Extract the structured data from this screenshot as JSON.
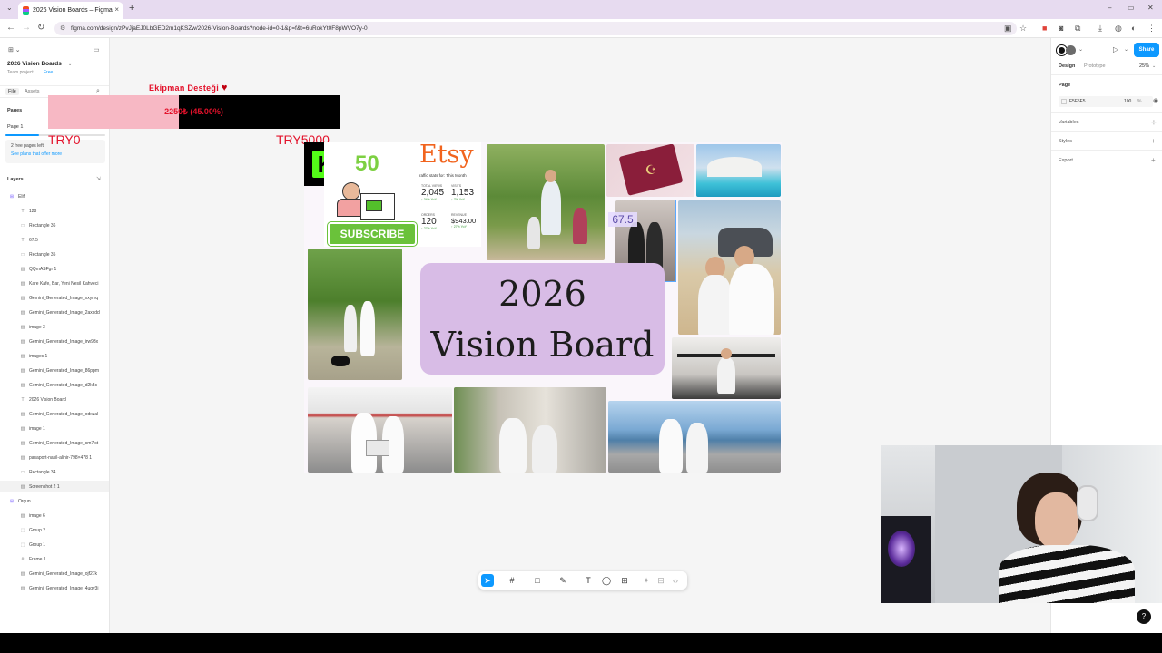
{
  "browser": {
    "tab_title": "2026 Vision Boards – Figma",
    "tab_close": "×",
    "new_tab": "+",
    "url": "figma.com/design/zPvJjaEJ0LbGED2m1qKSZw/2026-Vision-Boards?node-id=0-1&p=f&t=6uRokYt0F8pWVO7y-0",
    "window_minimize": "–",
    "window_maximize": "▭",
    "window_close": "✕"
  },
  "left_panel": {
    "file_name": "2026 Vision Boards",
    "team": "Team project",
    "plan": "Free",
    "tab_file": "File",
    "tab_assets": "Assets",
    "pages_header": "Pages",
    "page_1": "Page 1",
    "pages_left": "2 free pages left",
    "see_plans": "See plans that offer more",
    "layers_header": "Layers",
    "layers": [
      {
        "name": "Elif",
        "type": "section"
      },
      {
        "name": "128",
        "type": "text"
      },
      {
        "name": "Rectangle 36",
        "type": "rect"
      },
      {
        "name": "67.5",
        "type": "text"
      },
      {
        "name": "Rectangle 35",
        "type": "rect"
      },
      {
        "name": "QQmASFgr 1",
        "type": "image"
      },
      {
        "name": "Kare Kafe, Bar, Yeni Nesil Kahveci",
        "type": "image"
      },
      {
        "name": "Gemini_Generated_Image_xxymq",
        "type": "image"
      },
      {
        "name": "Gemini_Generated_Image_2axcdd",
        "type": "image"
      },
      {
        "name": "image 3",
        "type": "image"
      },
      {
        "name": "Gemini_Generated_Image_irw93x",
        "type": "image"
      },
      {
        "name": "images 1",
        "type": "image"
      },
      {
        "name": "Gemini_Generated_Image_86ppm",
        "type": "image"
      },
      {
        "name": "Gemini_Generated_Image_d2k5c",
        "type": "image"
      },
      {
        "name": "2026 Vision Board",
        "type": "text"
      },
      {
        "name": "Gemini_Generated_Image_odxzal",
        "type": "image"
      },
      {
        "name": "image 1",
        "type": "image"
      },
      {
        "name": "Gemini_Generated_Image_sm7jst",
        "type": "image"
      },
      {
        "name": "pasaport-nasil-alinir-798×478 1",
        "type": "image"
      },
      {
        "name": "Rectangle 34",
        "type": "rect"
      },
      {
        "name": "Screenshot 2 1",
        "type": "image"
      },
      {
        "name": "Orçun",
        "type": "section"
      },
      {
        "name": "image 6",
        "type": "image"
      },
      {
        "name": "Group 2",
        "type": "group"
      },
      {
        "name": "Group 1",
        "type": "group"
      },
      {
        "name": "Frame 1",
        "type": "frame"
      },
      {
        "name": "Gemini_Generated_Image_ojf27k",
        "type": "image"
      },
      {
        "name": "Gemini_Generated_Image_4ugv3j",
        "type": "image"
      }
    ]
  },
  "right_panel": {
    "tab_design": "Design",
    "tab_prototype": "Prototype",
    "zoom": "25%",
    "share": "Share",
    "page_header": "Page",
    "page_color": "F5F5F5",
    "page_opacity": "100",
    "percent": "%",
    "variables": "Variables",
    "styles": "Styles",
    "export": "Export"
  },
  "canvas": {
    "donation_title": "Ekipman Desteği",
    "donation_heart": "♥",
    "progress_text": "2250₺ (45.00%)",
    "progress_fraction": 0.45,
    "goal_start": "TRY0",
    "goal_end": "TRY5000",
    "kick_logo": "K",
    "kick_number": "50",
    "subscribe": "SUBSCRIBE",
    "etsy": {
      "logo": "Etsy",
      "subtitle": "raffic stats for: This Month",
      "stats": [
        {
          "label": "TOTAL VIEWS",
          "value": "2,045",
          "note": "↑ 34% YoY"
        },
        {
          "label": "VISITS",
          "value": "1,153",
          "note": "↑ 7% YoY"
        },
        {
          "label": "ORDERS",
          "value": "120",
          "note": "↑ 27% YoY"
        },
        {
          "label": "REVENUE",
          "value": "$943.00",
          "note": "↑ 27% YoY"
        }
      ]
    },
    "label_675": "67.5",
    "board_year": "2026",
    "board_title": "Vision Board"
  },
  "colors": {
    "figma_blue": "#0d99ff",
    "board_purple": "#d8bce6",
    "subscribe_green": "#6ac23a",
    "progress_pink": "#f7b8c4",
    "goal_red": "#e3122b",
    "etsy_orange": "#f1641e"
  }
}
